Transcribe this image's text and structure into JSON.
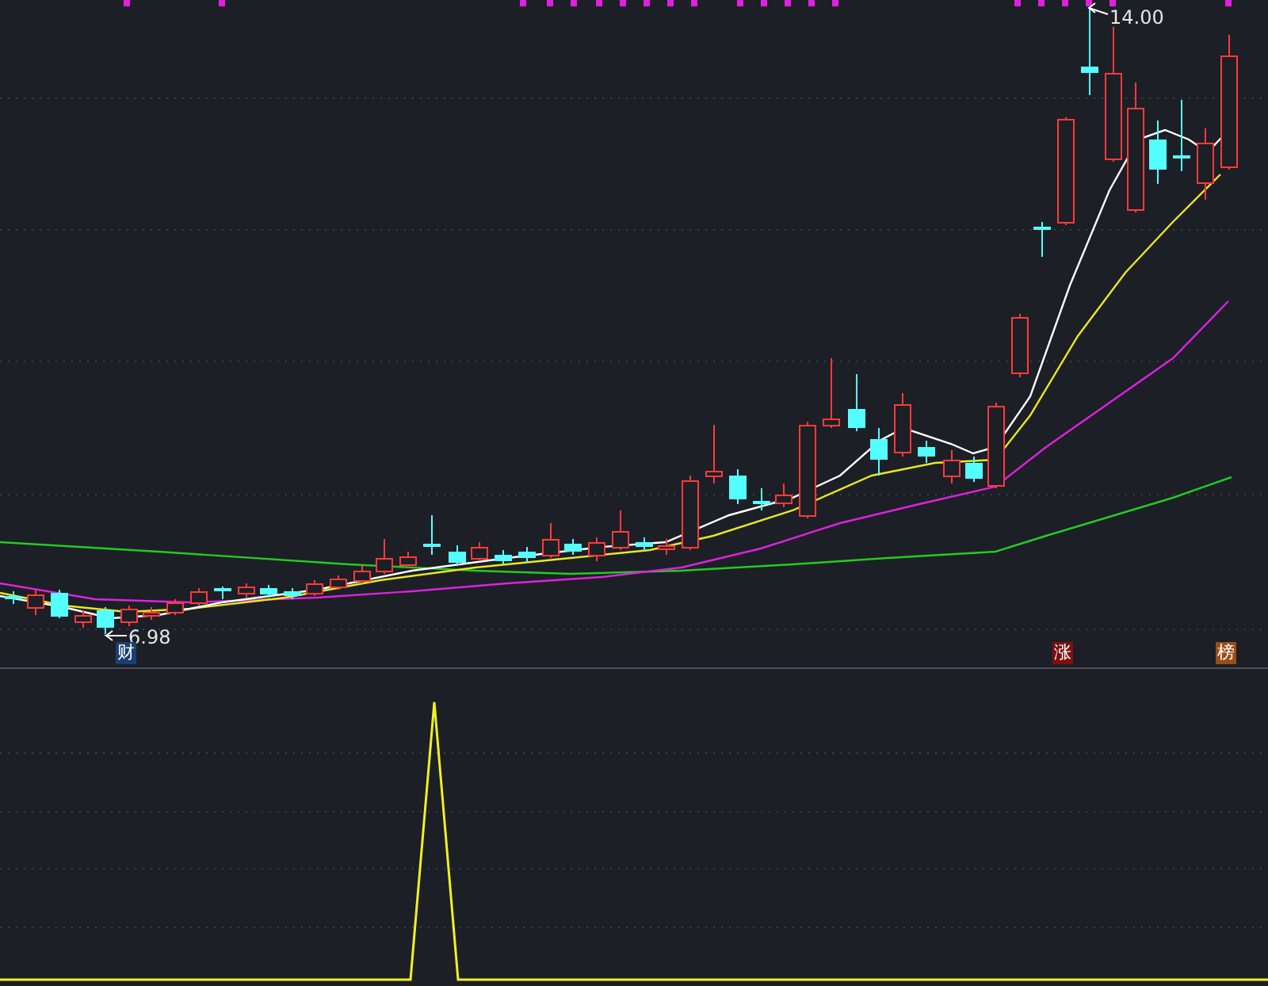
{
  "price_labels": [
    {
      "kind": "high",
      "text": "14.00"
    },
    {
      "kind": "low",
      "text": "6.98"
    }
  ],
  "event_badges": [
    {
      "text": "财",
      "color": "#1c3f73"
    },
    {
      "text": "涨",
      "color": "#7c1010"
    },
    {
      "text": "榜",
      "color": "#9a4e14"
    }
  ]
}
